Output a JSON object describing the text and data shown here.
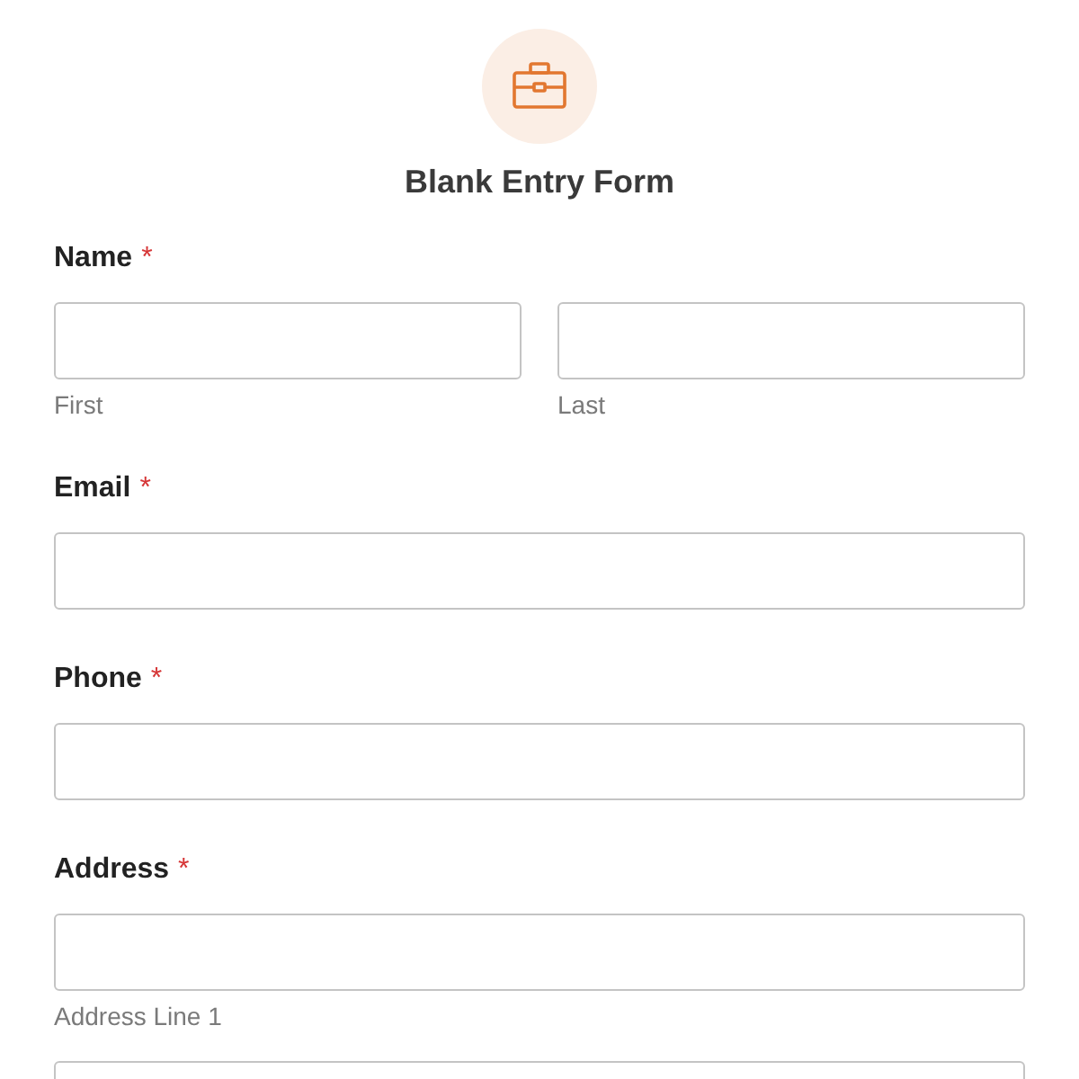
{
  "header": {
    "title": "Blank Entry Form"
  },
  "fields": [
    {
      "label": "Name",
      "required_mark": "*",
      "kind": "split",
      "inputs": [
        {
          "kind": "text",
          "sublabel": "First"
        },
        {
          "kind": "text",
          "sublabel": "Last"
        }
      ]
    },
    {
      "label": "Email",
      "required_mark": "*",
      "kind": "single",
      "inputs": [
        {
          "kind": "text"
        }
      ]
    },
    {
      "label": "Phone",
      "required_mark": "*",
      "kind": "single",
      "inputs": [
        {
          "kind": "text"
        }
      ]
    },
    {
      "label": "Address",
      "required_mark": "*",
      "kind": "single",
      "inputs": [
        {
          "kind": "text",
          "sublabel": "Address Line 1"
        },
        {
          "kind": "text"
        }
      ]
    }
  ]
}
